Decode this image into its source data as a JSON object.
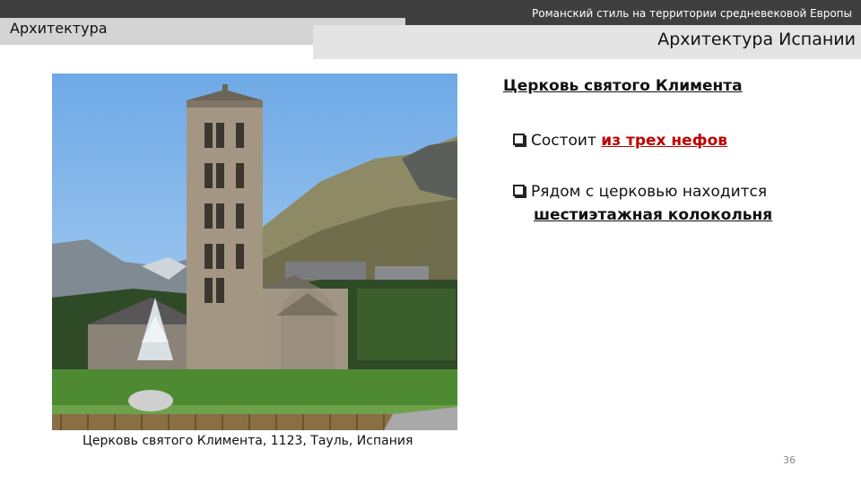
{
  "header": {
    "series_title": "Романский стиль на территории средневековой Европы",
    "section_title": "Архитектура",
    "topic_title": "Архитектура Испании"
  },
  "photo": {
    "caption": "Церковь святого Климента, 1123, Тауль, Испания"
  },
  "content": {
    "heading": "Церковь святого Климента",
    "bullets": [
      {
        "text": "Состоит ",
        "highlight": "из трех нефов"
      },
      {
        "text": "Рядом с церковью находится",
        "highlight": "шестиэтажная колокольня"
      }
    ]
  },
  "page_number": "36",
  "colors": {
    "top_bar": "#3f3f3f",
    "left_band": "#d4d4d4",
    "right_band": "#e4e4e4",
    "highlight_red": "#c00000"
  }
}
